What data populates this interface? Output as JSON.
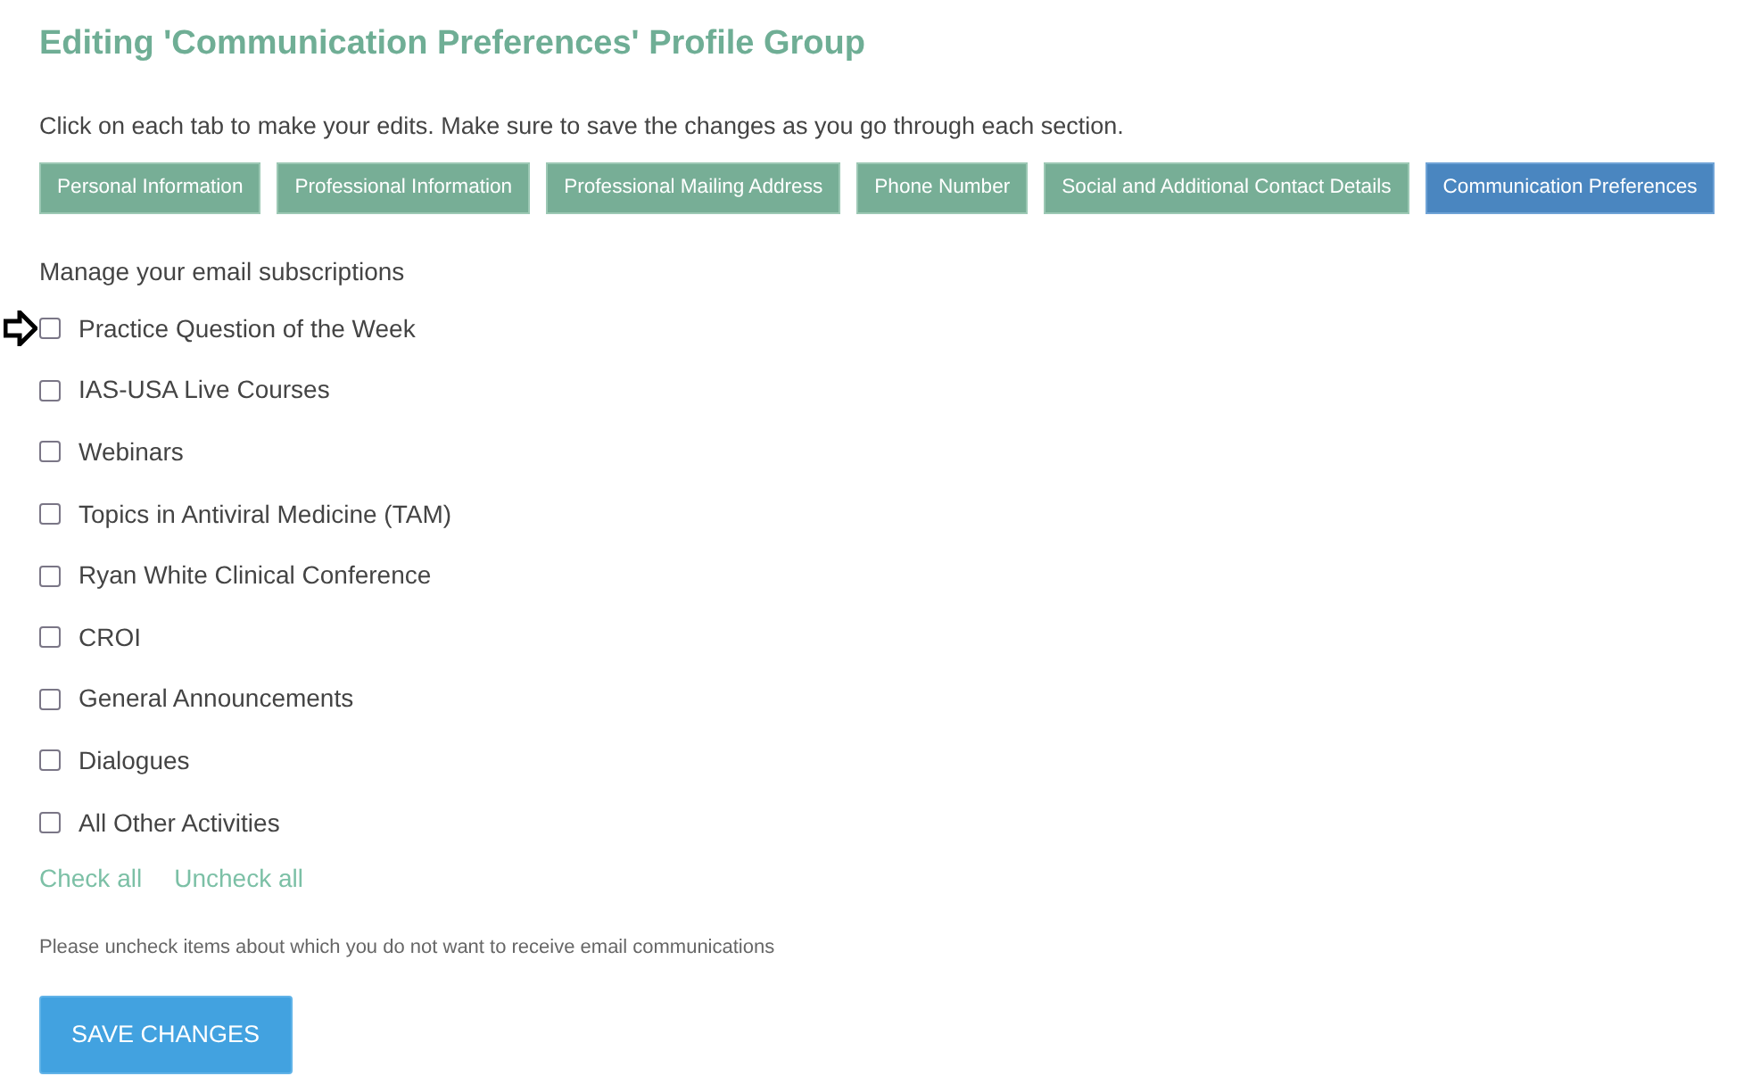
{
  "title": "Editing 'Communication Preferences' Profile Group",
  "instructions": "Click on each tab to make your edits. Make sure to save the changes as you go through each section.",
  "tabs": [
    {
      "label": "Personal Information",
      "selected": false
    },
    {
      "label": "Professional Information",
      "selected": false
    },
    {
      "label": "Professional Mailing Address",
      "selected": false
    },
    {
      "label": "Phone Number",
      "selected": false
    },
    {
      "label": "Social and Additional Contact Details",
      "selected": false
    },
    {
      "label": "Communication Preferences",
      "selected": true
    }
  ],
  "section_heading": "Manage your email subscriptions",
  "subscriptions": [
    {
      "label": "Practice Question of the Week",
      "checked": false,
      "pointed": true
    },
    {
      "label": "IAS-USA Live Courses",
      "checked": false,
      "pointed": false
    },
    {
      "label": "Webinars",
      "checked": false,
      "pointed": false
    },
    {
      "label": "Topics in Antiviral Medicine (TAM)",
      "checked": false,
      "pointed": false
    },
    {
      "label": "Ryan White Clinical Conference",
      "checked": false,
      "pointed": false
    },
    {
      "label": "CROI",
      "checked": false,
      "pointed": false
    },
    {
      "label": "General Announcements",
      "checked": false,
      "pointed": false
    },
    {
      "label": "Dialogues",
      "checked": false,
      "pointed": false
    },
    {
      "label": "All Other Activities",
      "checked": false,
      "pointed": false
    }
  ],
  "links": [
    "Check all",
    "Uncheck all"
  ],
  "note": "Please uncheck items about which you do not want to receive email communications",
  "save_button": "SAVE CHANGES"
}
